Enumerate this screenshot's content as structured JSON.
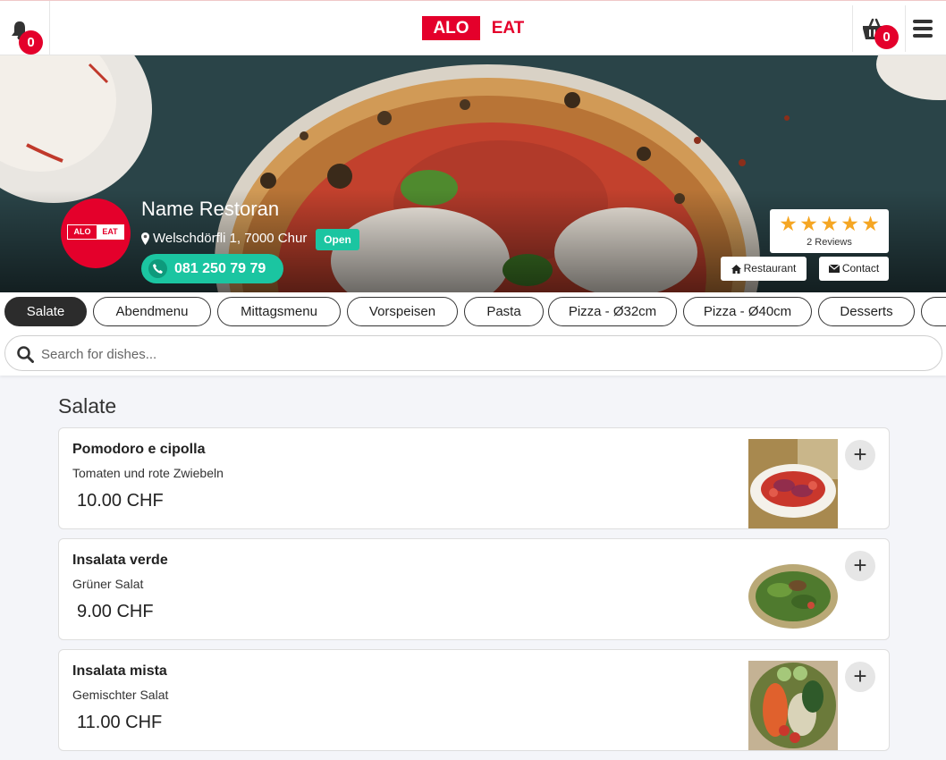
{
  "header": {
    "logo_left": "ALO",
    "logo_right": "EAT",
    "notification_count": "0",
    "cart_count": "0",
    "icons": [
      "bell-icon",
      "basket-icon",
      "hamburger-menu-icon"
    ]
  },
  "restaurant": {
    "logo_left": "ALO",
    "logo_right": "EAT",
    "name": "Name Restoran",
    "address": "Welschdörfli 1, 7000 Chur",
    "status": "Open",
    "phone": "081 250 79 79",
    "rating": 5,
    "reviews": "2 Reviews",
    "restaurant_button": "Restaurant",
    "contact_button": "Contact"
  },
  "categories": [
    {
      "label": "Salate",
      "active": true
    },
    {
      "label": "Abendmenu",
      "active": false
    },
    {
      "label": "Mittagsmenu",
      "active": false
    },
    {
      "label": "Vorspeisen",
      "active": false
    },
    {
      "label": "Pasta",
      "active": false
    },
    {
      "label": "Pizza - Ø32cm",
      "active": false
    },
    {
      "label": "Pizza - Ø40cm",
      "active": false
    },
    {
      "label": "Desserts",
      "active": false
    }
  ],
  "search": {
    "placeholder": "Search for dishes..."
  },
  "section": {
    "title": "Salate"
  },
  "items": [
    {
      "name": "Pomodoro e cipolla",
      "description": "Tomaten und rote Zwiebeln",
      "price": "10.00 CHF"
    },
    {
      "name": "Insalata verde",
      "description": "Grüner Salat",
      "price": "9.00 CHF"
    },
    {
      "name": "Insalata mista",
      "description": "Gemischter Salat",
      "price": "11.00 CHF"
    }
  ],
  "colors": {
    "brand": "#e4002b",
    "accent": "#1bc5a1",
    "star": "#f5a623"
  }
}
